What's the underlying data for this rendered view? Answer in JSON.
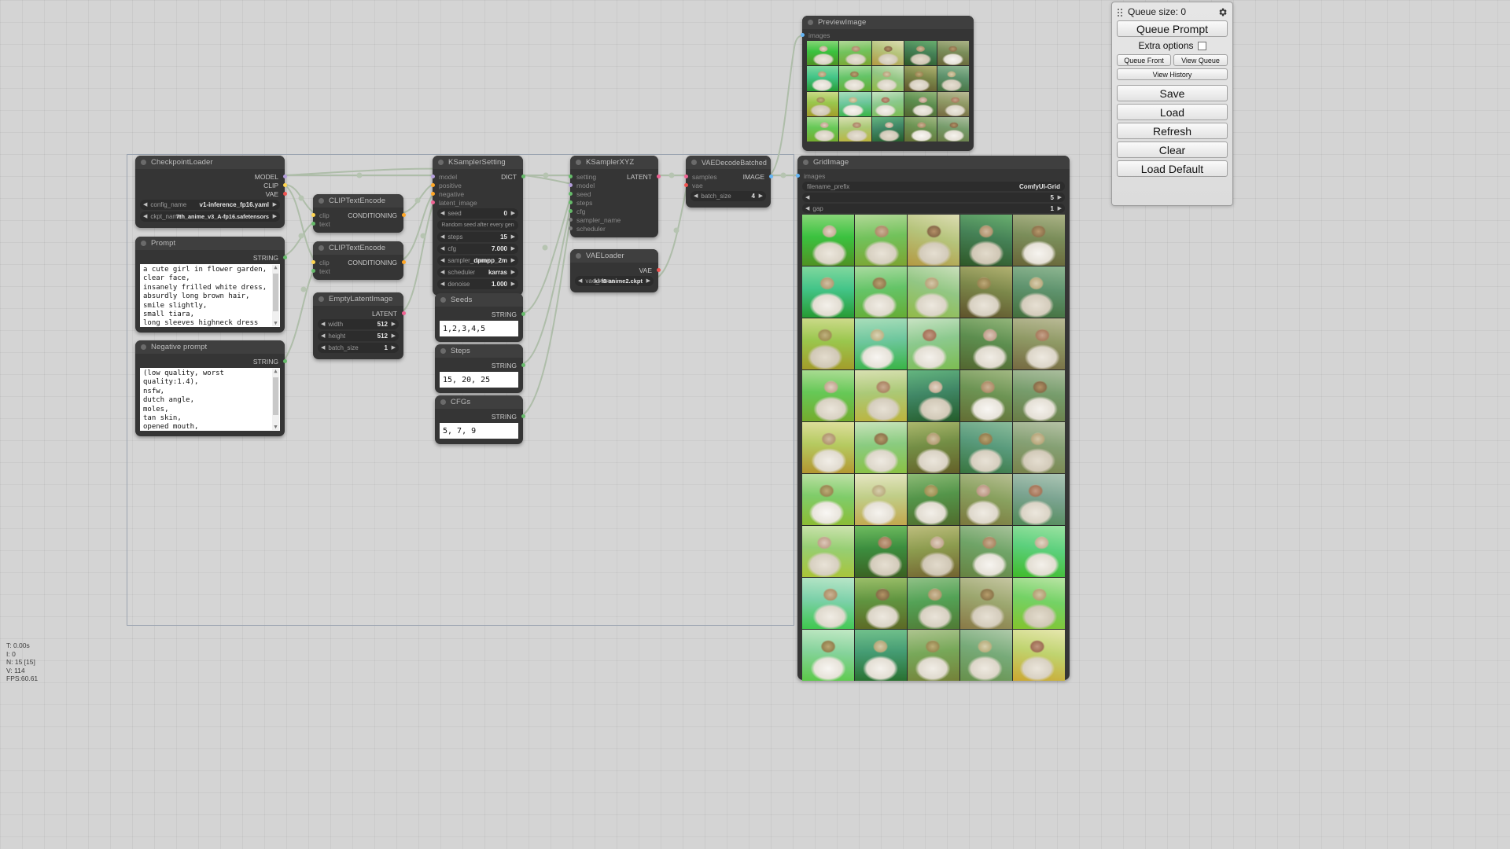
{
  "panel": {
    "queue_size_label": "Queue size: 0",
    "gear_icon": "gear-icon",
    "drag_handle_icon": "drag-handle-icon",
    "queue_prompt": "Queue Prompt",
    "extra_options": "Extra options",
    "queue_front": "Queue Front",
    "view_queue": "View Queue",
    "view_history": "View History",
    "save": "Save",
    "load": "Load",
    "refresh": "Refresh",
    "clear": "Clear",
    "load_default": "Load Default"
  },
  "stats": {
    "line1": "T: 0.00s",
    "line2": "I: 0",
    "line3": "N: 15 [15]",
    "line4": "V: 114",
    "line5": "FPS:60.61"
  },
  "nodes": {
    "checkpoint_loader": {
      "title": "CheckpointLoader",
      "outputs": [
        "MODEL",
        "CLIP",
        "VAE"
      ],
      "widgets": [
        {
          "name": "config_name",
          "value": "v1-inference_fp16.yaml"
        },
        {
          "name": "ckpt_name",
          "value": "7th_anime_v3_A-fp16.safetensors"
        }
      ]
    },
    "prompt": {
      "title": "Prompt",
      "output": "STRING",
      "text": "a cute girl in flower garden,\nclear face,\ninsanely frilled white dress,\nabsurdly long brown hair,\nsmile slightly,\nsmall tiara,\nlong sleeves highneck dress"
    },
    "negative_prompt": {
      "title": "Negative prompt",
      "output": "STRING",
      "text": "(low quality, worst\nquality:1.4),\nnsfw,\ndutch angle,\nmoles,\ntan skin,\nopened mouth,"
    },
    "clip_text_encode_1": {
      "title": "CLIPTextEncode",
      "inputs": [
        "clip",
        "text"
      ],
      "output": "CONDITIONING"
    },
    "clip_text_encode_2": {
      "title": "CLIPTextEncode",
      "inputs": [
        "clip",
        "text"
      ],
      "output": "CONDITIONING"
    },
    "empty_latent_image": {
      "title": "EmptyLatentImage",
      "output": "LATENT",
      "widgets": [
        {
          "name": "width",
          "value": "512"
        },
        {
          "name": "height",
          "value": "512"
        },
        {
          "name": "batch_size",
          "value": "1"
        }
      ]
    },
    "ksampler_setting": {
      "title": "KSamplerSetting",
      "inputs": [
        "model",
        "positive",
        "negative",
        "latent_image"
      ],
      "output": "DICT",
      "widgets": [
        {
          "name": "seed",
          "value": "0"
        },
        {
          "name": "steps",
          "value": "15"
        },
        {
          "name": "cfg",
          "value": "7.000"
        },
        {
          "name": "sampler_name",
          "value": "dpmpp_2m"
        },
        {
          "name": "scheduler",
          "value": "karras"
        },
        {
          "name": "denoise",
          "value": "1.000"
        }
      ],
      "control_widget": "Random seed after every gen"
    },
    "ksampler_xyz": {
      "title": "KSamplerXYZ",
      "inputs": [
        "setting",
        "model",
        "seed",
        "steps",
        "cfg",
        "sampler_name",
        "scheduler"
      ],
      "output": "LATENT"
    },
    "vae_loader": {
      "title": "VAELoader",
      "output": "VAE",
      "widgets": [
        {
          "name": "vae_name",
          "value": "kl-f8-anime2.ckpt"
        }
      ]
    },
    "vae_decode_batched": {
      "title": "VAEDecodeBatched",
      "inputs": [
        "samples",
        "vae"
      ],
      "output": "IMAGE",
      "widgets": [
        {
          "name": "batch_size",
          "value": "4"
        }
      ]
    },
    "seeds": {
      "title": "Seeds",
      "output": "STRING",
      "text": "1,2,3,4,5"
    },
    "steps": {
      "title": "Steps",
      "output": "STRING",
      "text": "15, 20, 25"
    },
    "cfgs": {
      "title": "CFGs",
      "output": "STRING",
      "text": "5, 7, 9"
    },
    "preview_image": {
      "title": "PreviewImage",
      "input": "images",
      "grid": {
        "cols": 5,
        "rows": 4
      }
    },
    "grid_image": {
      "title": "GridImage",
      "input": "images",
      "widgets": [
        {
          "name": "filename_prefix",
          "value": "ComfyUI-Grid"
        },
        {
          "name": "",
          "value": "5"
        },
        {
          "name": "gap",
          "value": "1"
        }
      ],
      "grid": {
        "cols": 5,
        "rows": 9
      }
    }
  },
  "colors": {
    "model": "#b39ddb",
    "clip": "#ffd54f",
    "vae": "#ef5350",
    "conditioning": "#ffa726",
    "latent": "#f06292",
    "image": "#64b5f6",
    "string": "#66bb6a",
    "node_bg": "#353535",
    "node_title_bg": "#3f3f3f",
    "canvas_bg": "#d4d4d4",
    "link": "#aebda9"
  }
}
